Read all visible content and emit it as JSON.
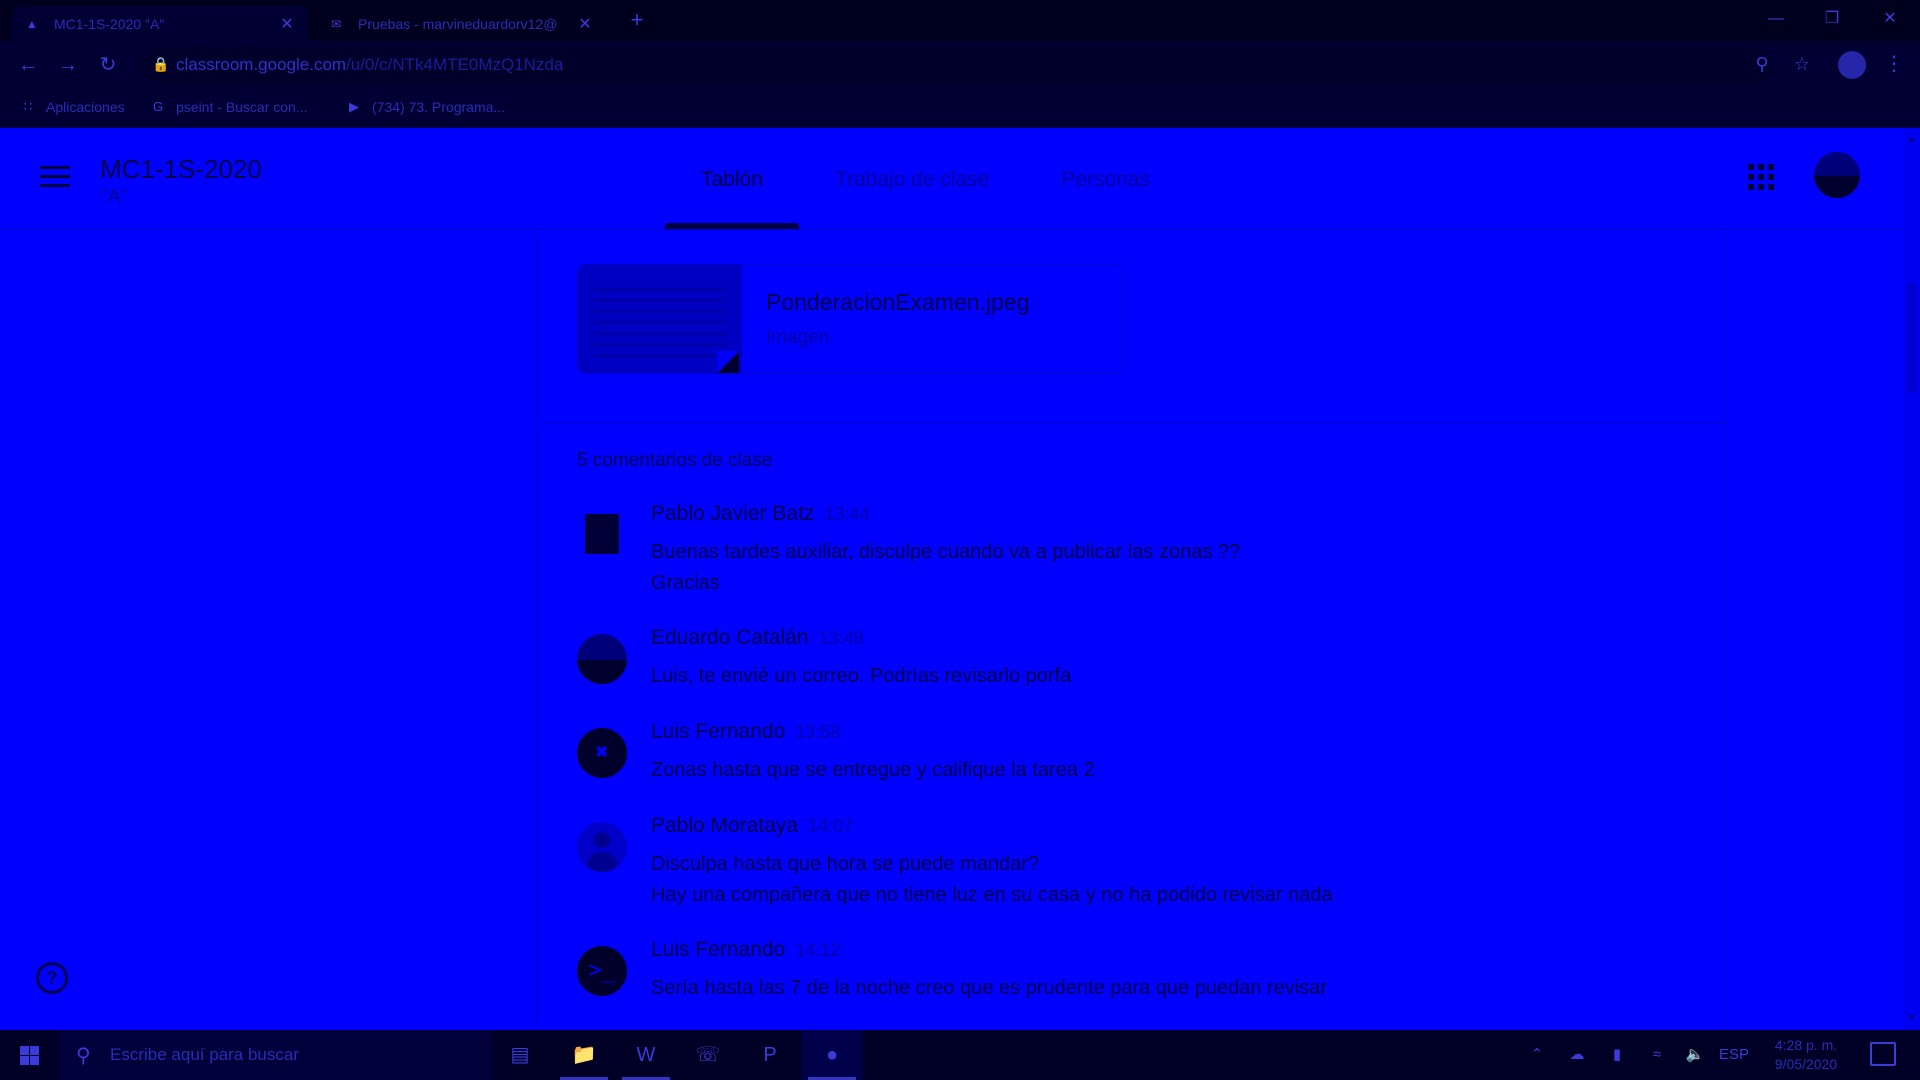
{
  "browser": {
    "tabs": [
      {
        "title": "MC1-1S-2020 \"A\"",
        "icon": "classroom-icon",
        "active": true
      },
      {
        "title": "Pruebas - marvineduardorv12@",
        "icon": "mail-icon",
        "active": false
      }
    ],
    "new_tab": "+",
    "url_host": "classroom.google.com",
    "url_path": "/u/0/c/NTk4MTE0MzQ1Nzda",
    "bookmarks": [
      {
        "label": "Aplicaciones",
        "icon": "apps-icon"
      },
      {
        "label": "pseint - Buscar con...",
        "icon": "google-icon"
      },
      {
        "label": "(734) 73. Programa...",
        "icon": "youtube-icon"
      }
    ]
  },
  "classroom": {
    "class_title": "MC1-1S-2020",
    "class_section": "\"A\"",
    "tabs": [
      {
        "label": "Tablón",
        "active": true
      },
      {
        "label": "Trabajo de clase",
        "active": false
      },
      {
        "label": "Personas",
        "active": false
      }
    ]
  },
  "post": {
    "attachment": {
      "name": "PonderacionExamen.jpeg",
      "type": "Imagen"
    },
    "comments_heading": "5 comentarios de clase",
    "comments": [
      {
        "author": "Pablo Javier Batz",
        "time": "13:44",
        "lines": [
          "Buenas tardes auxiliar, disculpe cuando va a publicar las zonas ??",
          "Gracias"
        ],
        "avatar": "photo-avatar"
      },
      {
        "author": "Eduardo Catalán",
        "time": "13:48",
        "lines": [
          "Luis, te envié un correo. Podrías revisarlo porfa"
        ],
        "avatar": "landscape-avatar"
      },
      {
        "author": "Luis Fernando",
        "time": "13:58",
        "lines": [
          "Zonas hasta que se entregue y califique la tarea 2"
        ],
        "avatar": "logo-avatar"
      },
      {
        "author": "Pablo Morataya",
        "time": "14:07",
        "lines": [
          "Disculpa hasta que hora se puede mandar?",
          "Hay una compañera que no tiene luz en su casa y no ha podido revisar nada"
        ],
        "avatar": "default-person-avatar"
      },
      {
        "author": "Luis Fernando",
        "time": "14:12",
        "lines": [
          "Sería hasta las 7 de la noche creo que es prudente para que puedan revisar"
        ],
        "avatar": "terminal-avatar"
      }
    ]
  },
  "taskbar": {
    "search_placeholder": "Escribe aquí para buscar",
    "language": "ESP",
    "time": "4:28 p. m.",
    "date": "9/05/2020"
  }
}
